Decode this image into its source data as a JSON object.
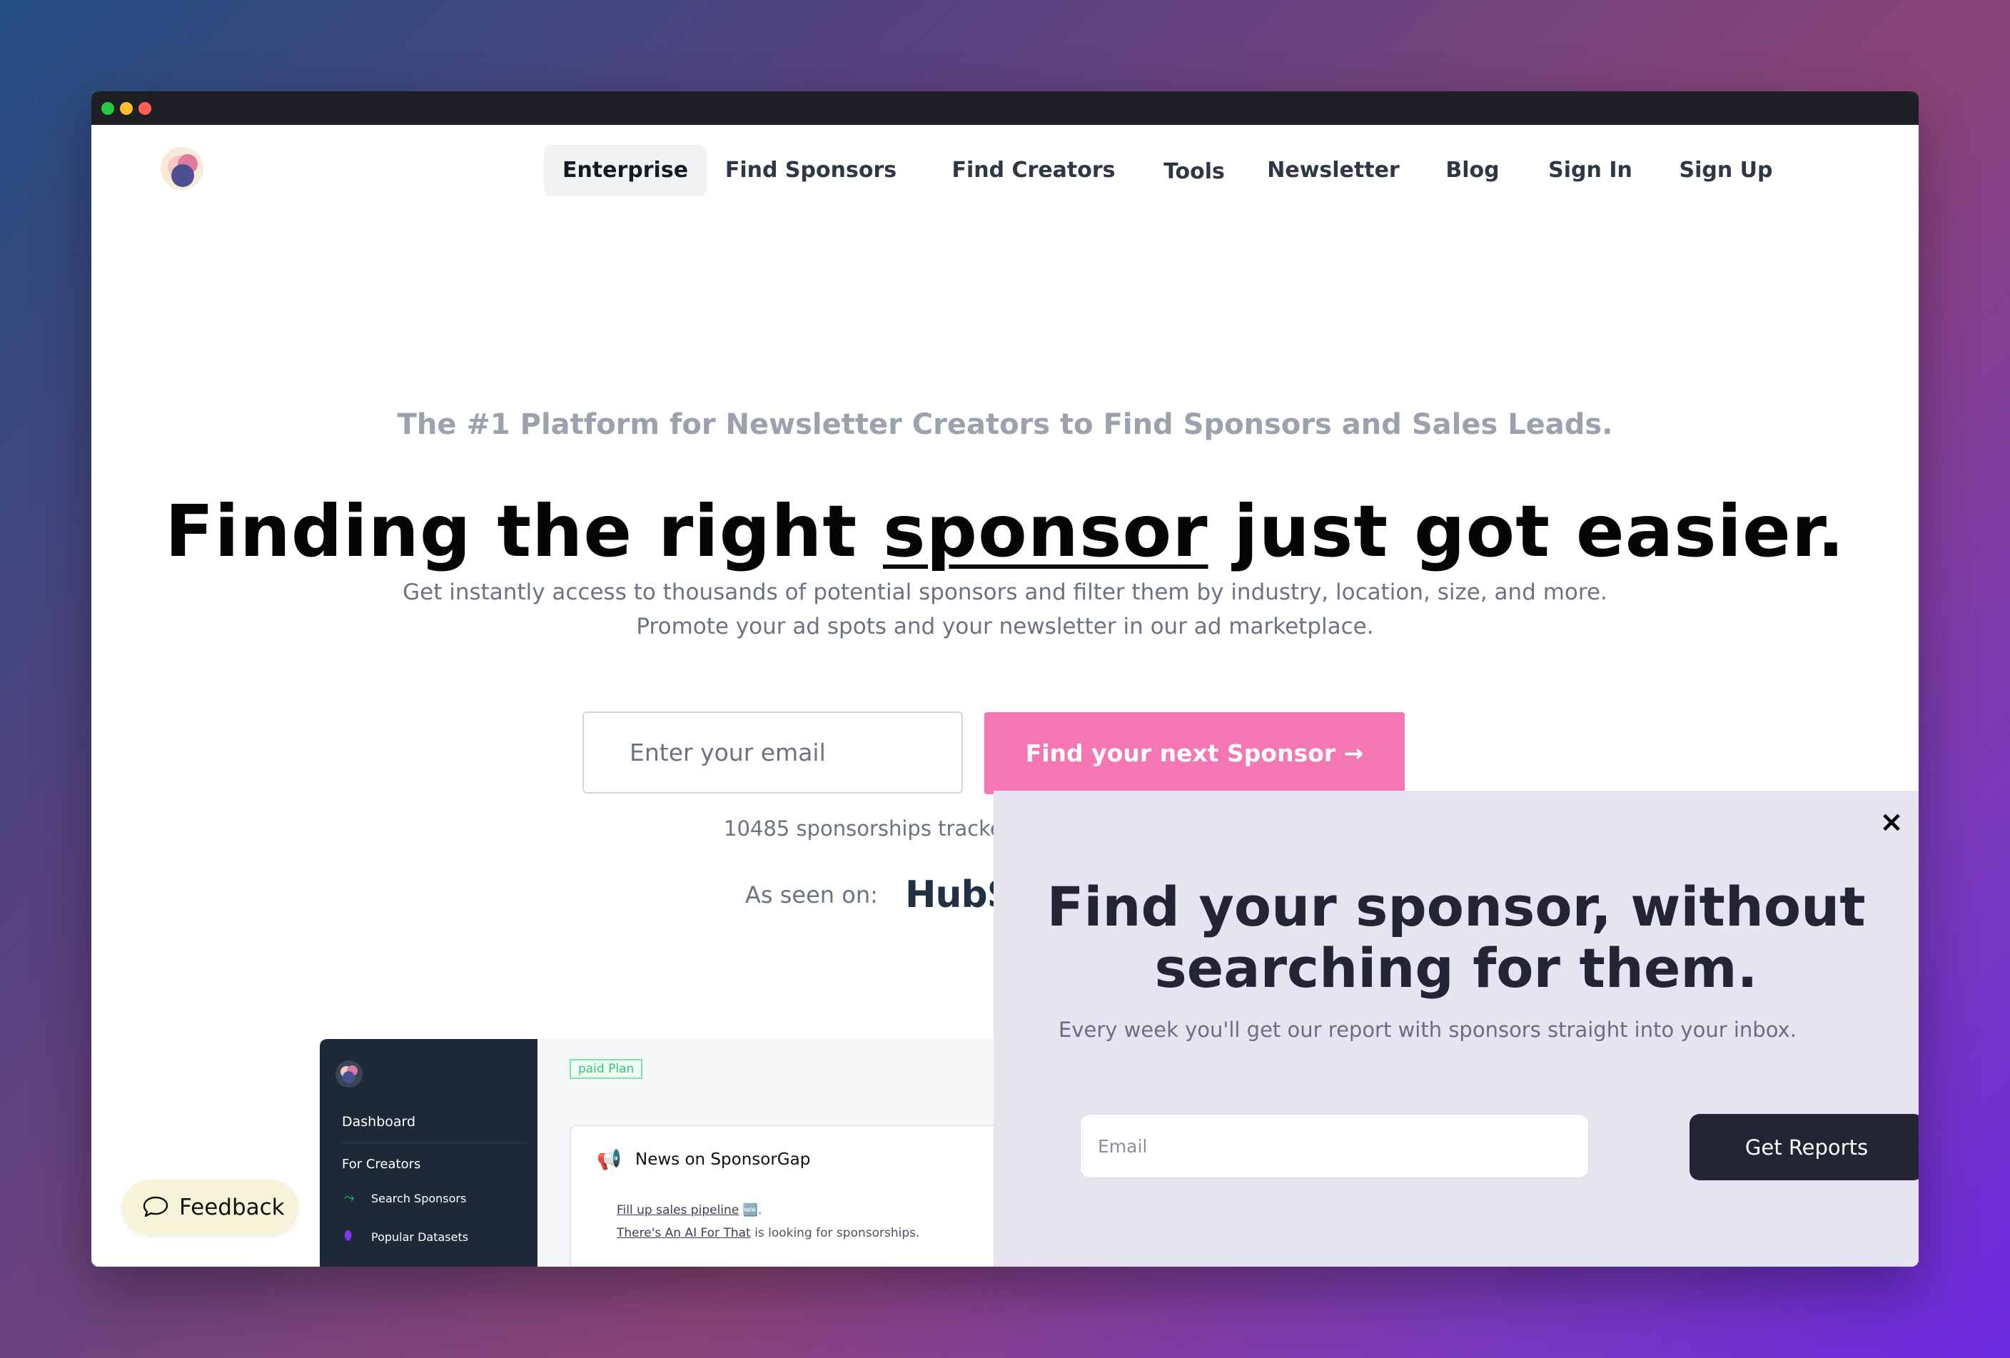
{
  "nav": {
    "items": [
      {
        "label": "Enterprise",
        "active": true
      },
      {
        "label": "Find Sponsors"
      },
      {
        "label": "Find Creators"
      },
      {
        "label": "Tools"
      },
      {
        "label": "Newsletter"
      },
      {
        "label": "Blog"
      },
      {
        "label": "Sign In"
      },
      {
        "label": "Sign Up"
      }
    ]
  },
  "hero": {
    "tagline": "The #1 Platform for Newsletter Creators to Find Sponsors and Sales Leads.",
    "headline_pre": "Finding the right ",
    "headline_underlined": "sponsor",
    "headline_post": " just got easier.",
    "sub1": "Get instantly access to thousands of potential sponsors and filter them by industry, location, size, and more.",
    "sub2": "Promote your ad spots and your newsletter in our ad marketplace.",
    "email_placeholder": "Enter your email",
    "cta_label": "Find your next Sponsor →",
    "tracked": "10485 sponsorships tracke",
    "seen_label": "As seen on:",
    "seen_logo": "HubS"
  },
  "preview": {
    "badge": "paid Plan",
    "dashboard": "Dashboard",
    "for_creators": "For Creators",
    "search_sponsors": "Search Sponsors",
    "popular_datasets": "Popular Datasets",
    "card_title": "News on SponsorGap",
    "line1_link": "Fill up sales pipeline",
    "line1_rest": " 🆕.",
    "line2_link": "There's An AI For That",
    "line2_rest": " is looking for sponsorships."
  },
  "popup": {
    "close": "×",
    "title_line1": "Find your sponsor, without",
    "title_line2": "searching for them.",
    "subtitle": "Every week you'll get our report with sponsors straight into your inbox.",
    "email_placeholder": "Email",
    "button": "Get Reports"
  },
  "feedback": {
    "label": "Feedback"
  },
  "colors": {
    "accent_pink": "#f476b3",
    "popup_bg": "#e7e4f2",
    "dark_button": "#232534"
  }
}
